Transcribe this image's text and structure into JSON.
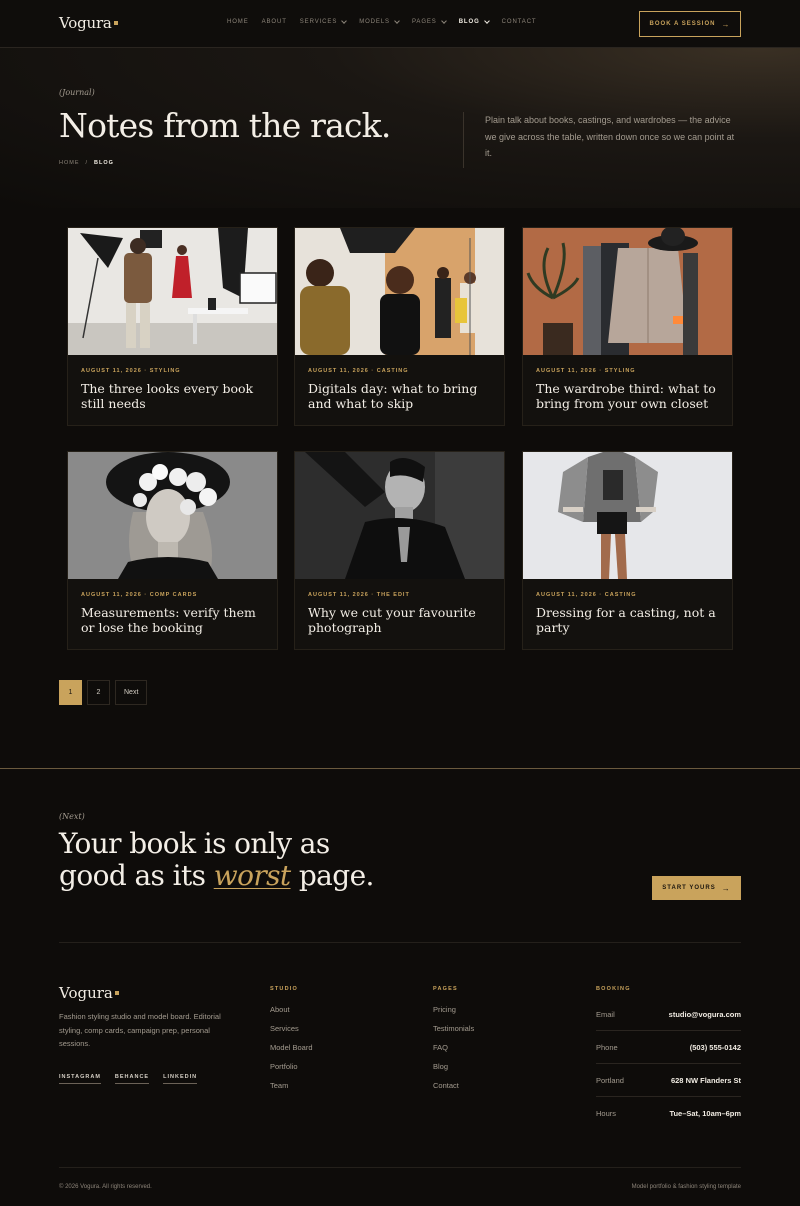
{
  "brand": {
    "name": "Vogura",
    "accent": "#c9a35c",
    "background": "#0e0c0a"
  },
  "nav": {
    "items": [
      {
        "label": "HOME",
        "dropdown": false,
        "active": false
      },
      {
        "label": "ABOUT",
        "dropdown": false,
        "active": false
      },
      {
        "label": "SERVICES",
        "dropdown": true,
        "active": false
      },
      {
        "label": "MODELS",
        "dropdown": true,
        "active": false
      },
      {
        "label": "PAGES",
        "dropdown": true,
        "active": false
      },
      {
        "label": "BLOG",
        "dropdown": true,
        "active": true
      },
      {
        "label": "CONTACT",
        "dropdown": false,
        "active": false
      }
    ],
    "cta": "BOOK A SESSION",
    "cta_icon": "arrow-right-icon"
  },
  "hero": {
    "kicker": "(Journal)",
    "title": "Notes from the rack.",
    "breadcrumb": {
      "home": "HOME",
      "sep": "/",
      "current": "BLOG"
    },
    "description": "Plain talk about books, castings, and wardrobes — the advice we give across the table, written down once so we can point at it."
  },
  "posts": [
    {
      "date": "AUGUST 11, 2026",
      "category": "STYLING",
      "title": "The three looks every book still needs",
      "image": "studio-photoshoot"
    },
    {
      "date": "AUGUST 11, 2026",
      "category": "CASTING",
      "title": "Digitals day: what to bring and what to skip",
      "image": "makeup-session"
    },
    {
      "date": "AUGUST 11, 2026",
      "category": "STYLING",
      "title": "The wardrobe third: what to bring from your own closet",
      "image": "clothing-rack"
    },
    {
      "date": "AUGUST 11, 2026",
      "category": "COMP CARDS",
      "title": "Measurements: verify them or lose the booking",
      "image": "floral-portrait"
    },
    {
      "date": "AUGUST 11, 2026",
      "category": "THE EDIT",
      "title": "Why we cut your favourite photograph",
      "image": "bw-portrait"
    },
    {
      "date": "AUGUST 11, 2026",
      "category": "CASTING",
      "title": "Dressing for a casting, not a party",
      "image": "model-poncho"
    }
  ],
  "pagination": {
    "pages": [
      "1",
      "2"
    ],
    "current": "1",
    "next": "Next"
  },
  "cta": {
    "kicker": "(Next)",
    "line1": "Your book is only as",
    "line2_pre": "good as its ",
    "line2_em": "worst",
    "line2_post": " page.",
    "button": "START YOURS",
    "button_icon": "arrow-right-icon"
  },
  "footer": {
    "about": "Fashion styling studio and model board. Editorial styling, comp cards, campaign prep, personal sessions.",
    "socials": [
      "INSTAGRAM",
      "BEHANCE",
      "LINKEDIN"
    ],
    "studio": {
      "heading": "STUDIO",
      "links": [
        "About",
        "Services",
        "Model Board",
        "Portfolio",
        "Team"
      ]
    },
    "pages": {
      "heading": "PAGES",
      "links": [
        "Pricing",
        "Testimonials",
        "FAQ",
        "Blog",
        "Contact"
      ]
    },
    "booking": {
      "heading": "BOOKING",
      "rows": [
        {
          "label": "Email",
          "value": "studio@vogura.com"
        },
        {
          "label": "Phone",
          "value": "(503) 555-0142"
        },
        {
          "label": "Portland",
          "value": "628 NW Flanders St"
        },
        {
          "label": "Hours",
          "value": "Tue–Sat, 10am–6pm"
        }
      ]
    },
    "copyright": "© 2026 Vogura. All rights reserved.",
    "tagline": "Model portfolio & fashion styling template"
  }
}
